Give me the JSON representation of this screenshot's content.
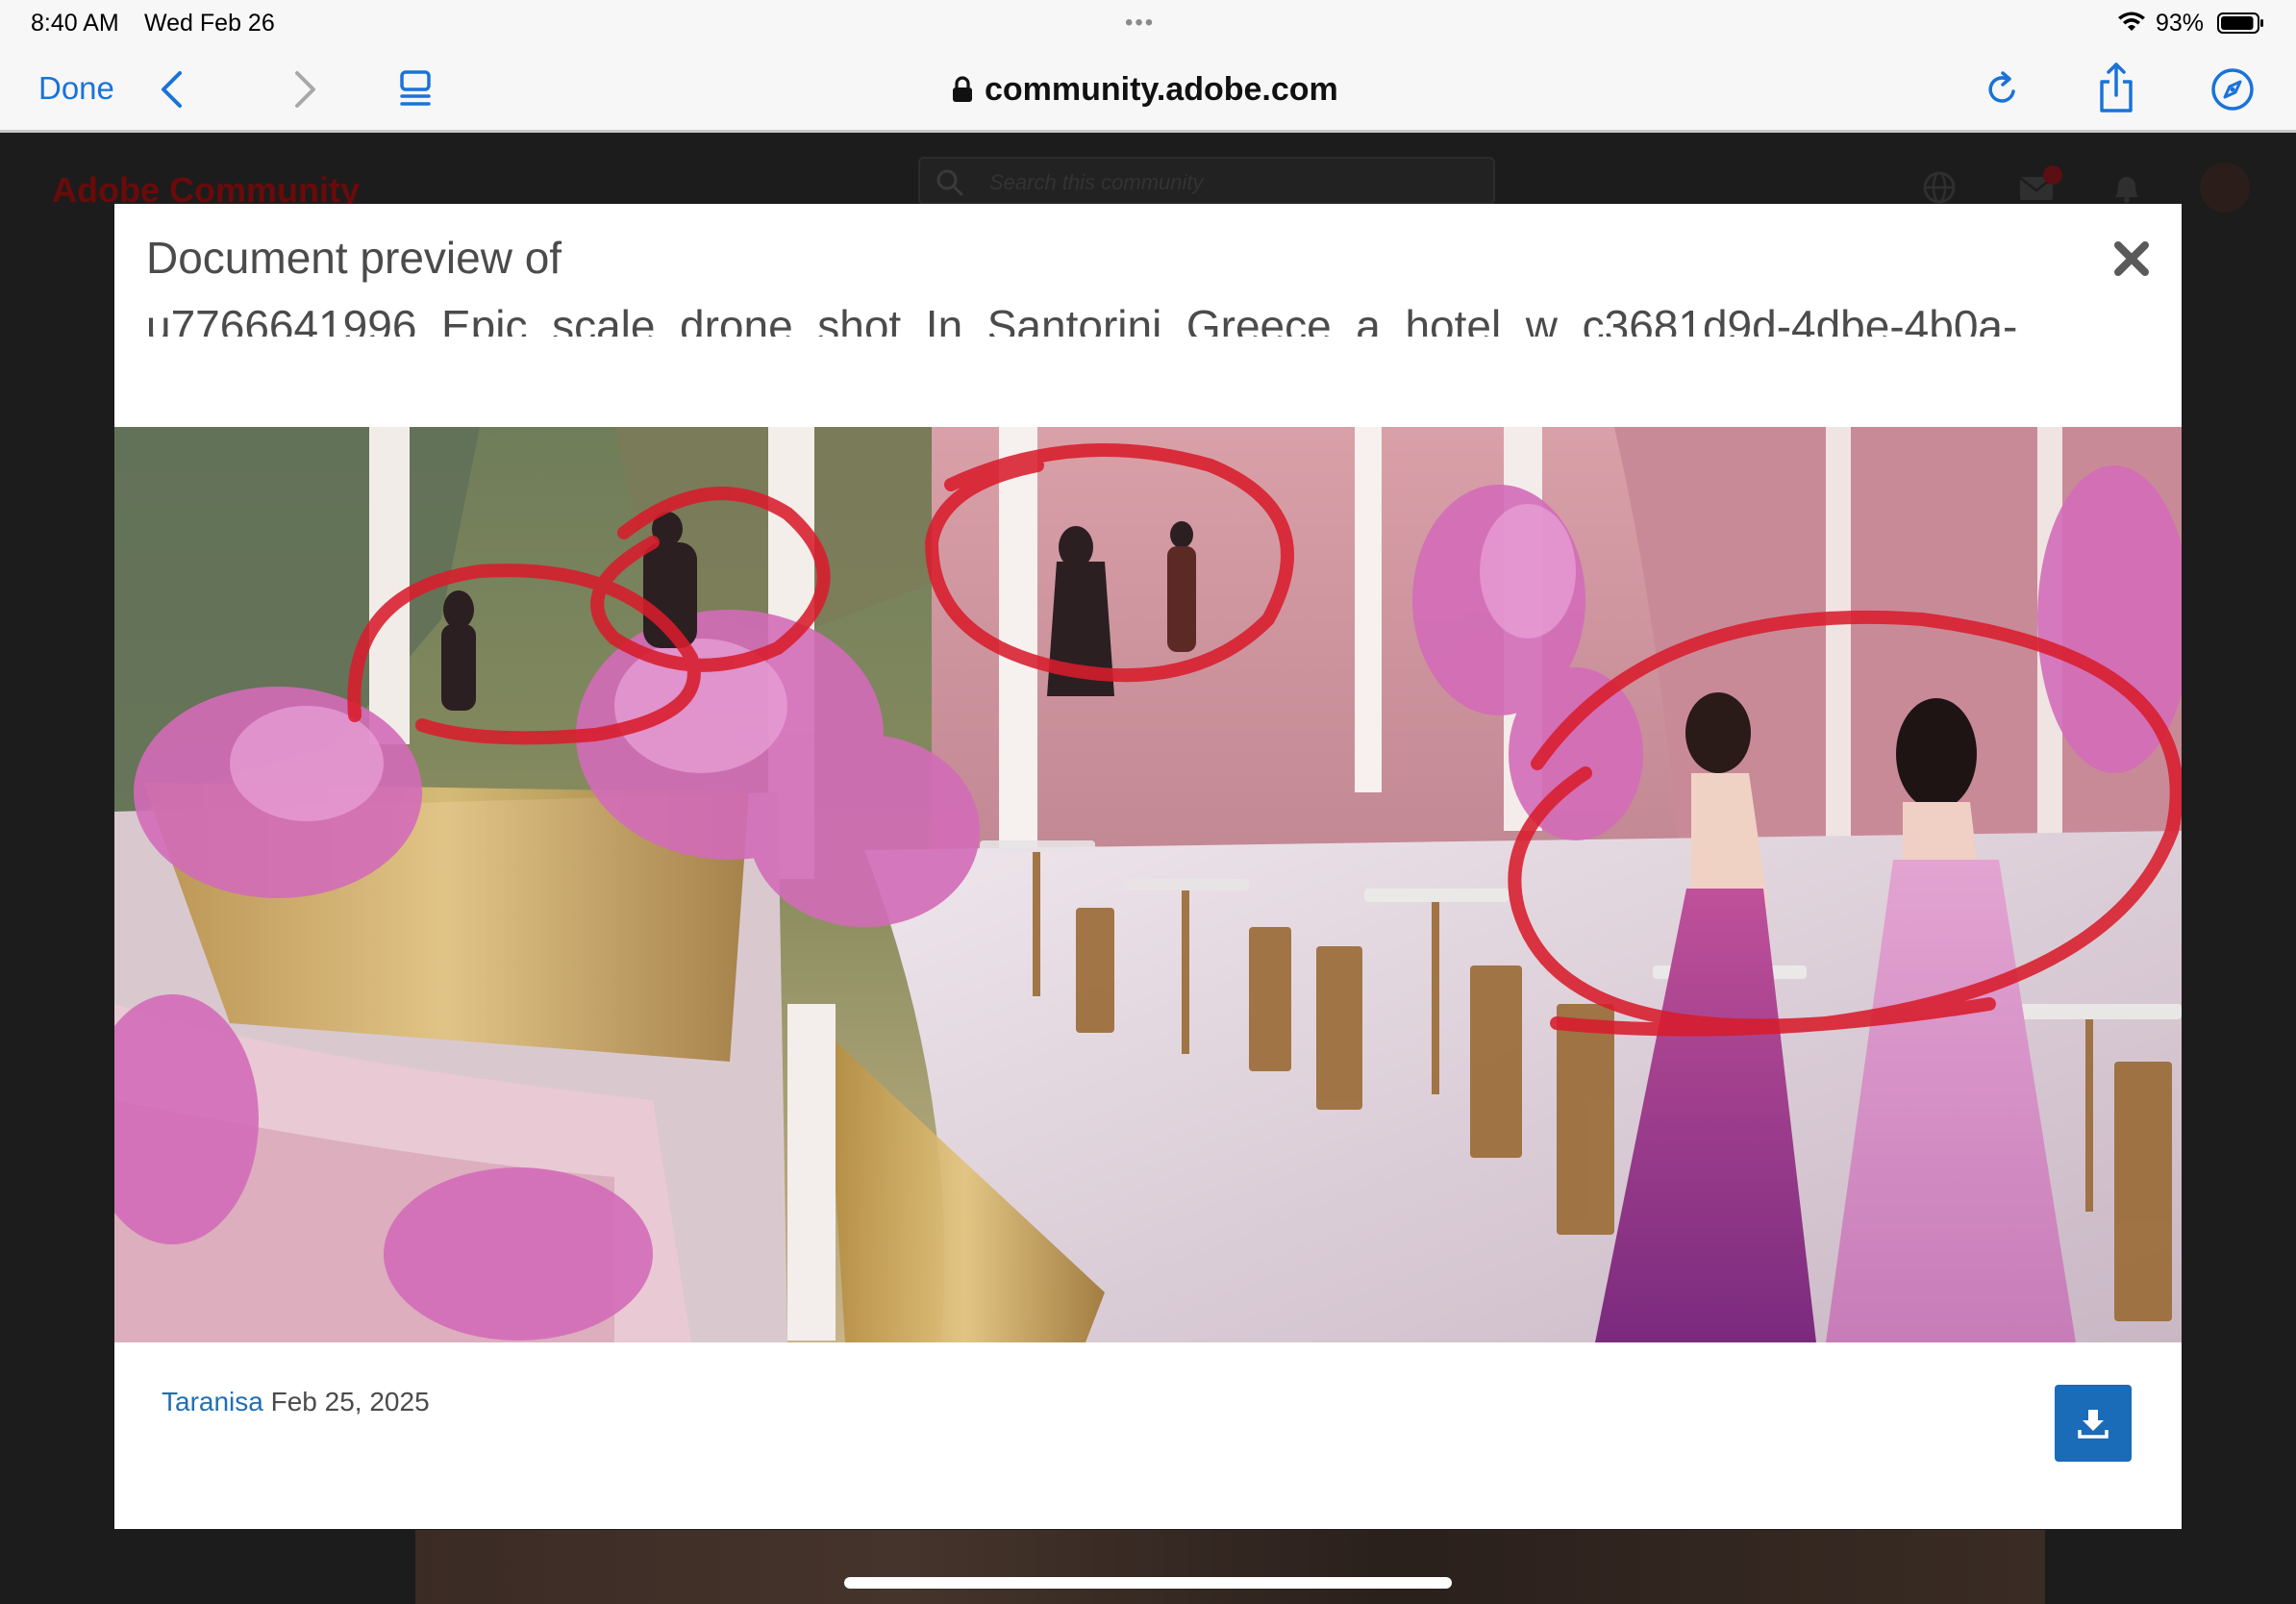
{
  "status_bar": {
    "time": "8:40 AM",
    "date": "Wed Feb 26",
    "dots": "•••",
    "battery_percent": "93%",
    "battery_level": 0.93
  },
  "toolbar": {
    "done_label": "Done",
    "url": "community.adobe.com",
    "icons": [
      "back-icon",
      "forward-icon",
      "reader-icon",
      "lock-icon",
      "reload-icon",
      "share-icon",
      "compass-icon"
    ],
    "accent_color": "#1a73d8"
  },
  "background_page": {
    "logo_text": "Adobe Community",
    "search_placeholder": "Search this community",
    "notification_count": "1"
  },
  "modal": {
    "title": "Document preview of",
    "filename": "u7766641996_Epic_scale_drone_shot_In_Santorini_Greece_a_hotel_w_c3681d9d-4dbe-4b0a-",
    "author": "Taranisa",
    "date": "Feb 25, 2025",
    "download_color": "#1a6bb8",
    "link_color": "#1f6fb5"
  }
}
